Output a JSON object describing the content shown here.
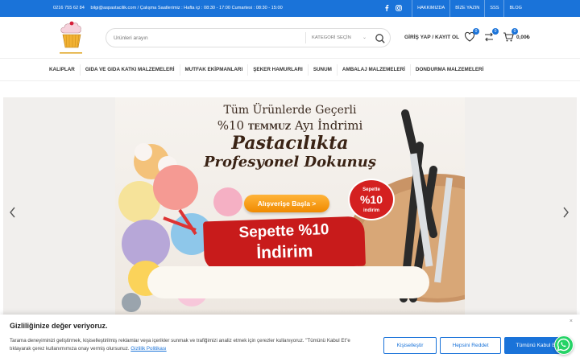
{
  "topbar": {
    "phone": "0216 755 62 84",
    "info": "bilgi@aspastacilik.com  / Çalışma Saatlerimiz : Hafta içi : 08:30 - 17:00 Cumartesi : 08:30 - 15:00",
    "links": [
      "HAKKIMIZDA",
      "BİZE YAZIN",
      "SSS",
      "BLOG"
    ],
    "social": [
      "facebook-icon",
      "instagram-icon"
    ]
  },
  "header": {
    "search_placeholder": "Ürünleri arayın",
    "category_label": "KATEGORİ SEÇİN",
    "login_label": "GİRİŞ YAP / KAYIT OL",
    "wishlist_count": "0",
    "compare_count": "0",
    "cart_count": "0",
    "cart_total": "0,00₺"
  },
  "nav": {
    "items": [
      "KALIPLAR",
      "GIDA VE GIDA KATKI MALZEMELERİ",
      "MUTFAK EKİPMANLARI",
      "ŞEKER HAMURLARI",
      "SUNUM",
      "AMBALAJ MALZEMELERİ",
      "DONDURMA MALZEMELERİ"
    ]
  },
  "banner": {
    "line1": "Tüm Ürünlerde Geçerli",
    "line2_a": "%10",
    "line2_b": "TEMMUZ",
    "line2_c": "Ayı İndrimi",
    "line3": "Pastacılıkta",
    "line4": "Profesyonel Dokunuş",
    "button": "Alışverişe Başla  >",
    "sticker_top": "Sepette",
    "sticker_mid": "%10",
    "sticker_bot": "indirim",
    "promo_top": "Sepette %10",
    "promo_bot": "İndirim"
  },
  "cookie": {
    "title": "Gizliliğinize değer veriyoruz.",
    "text": "Tarama deneyiminizi geliştirmek, kişiselleştirilmiş reklamlar veya içerikler sunmak ve trafiğimizi analiz etmek için çerezler kullanıyoruz. \"Tümünü Kabul Et\"e tıklayarak çerez kullanımımıza onay vermiş olursunuz.",
    "policy_link": "Gizlilik Politikası",
    "customize": "Kişiselleştir",
    "reject": "Hepsini Reddet",
    "accept": "Tümünü Kabul Et",
    "close": "×"
  },
  "colors": {
    "accent": "#1a73d9",
    "whatsapp": "#25d366",
    "promo_red": "#c81b1b"
  }
}
